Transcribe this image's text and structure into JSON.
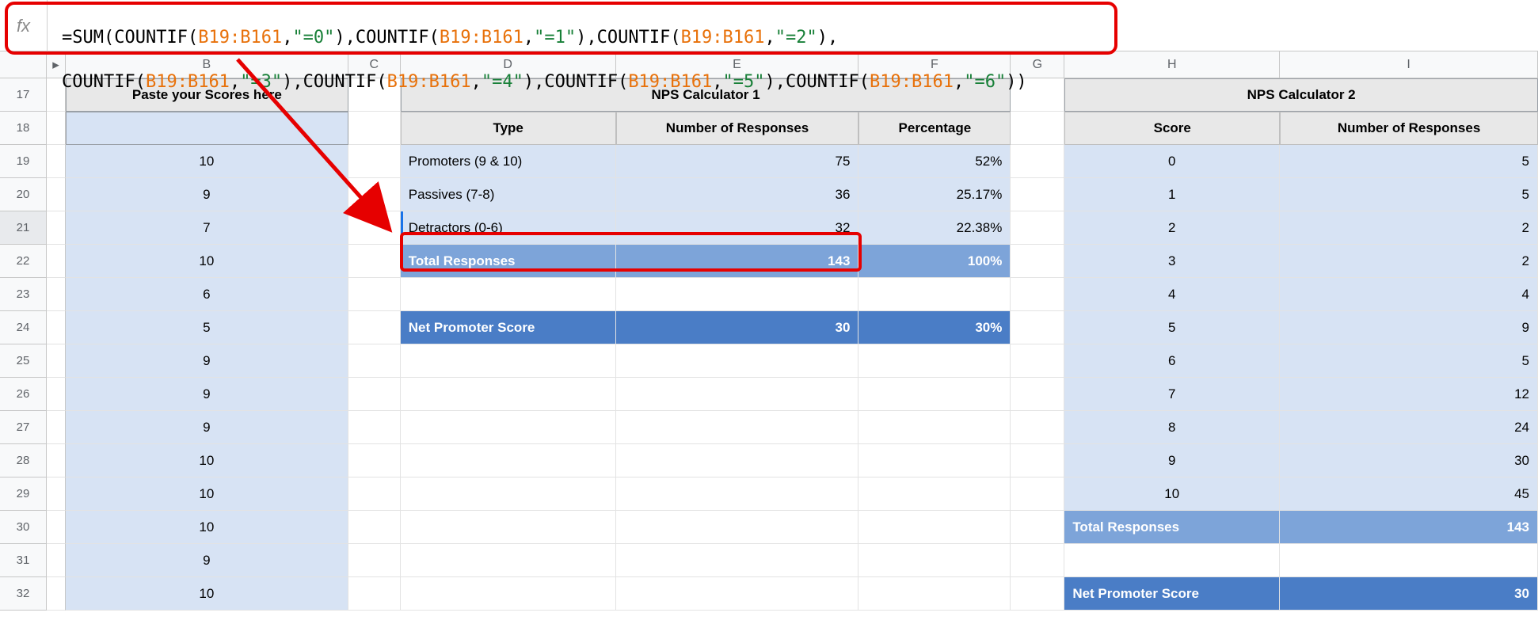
{
  "formula": {
    "text": "=SUM(COUNTIF(B19:B161,\"=0\"),COUNTIF(B19:B161,\"=1\"),COUNTIF(B19:B161,\"=2\"),\nCOUNTIF(B19:B161,\"=3\"),COUNTIF(B19:B161,\"=4\"),COUNTIF(B19:B161,\"=5\"),COUNTIF(B19:B161,\"=6\"))"
  },
  "columns": [
    "B",
    "C",
    "D",
    "E",
    "F",
    "G",
    "H",
    "I"
  ],
  "row_start": 17,
  "row_end": 32,
  "colB_header": "Paste your Scores here",
  "colB_values": [
    "",
    "10",
    "9",
    "7",
    "10",
    "6",
    "5",
    "9",
    "9",
    "9",
    "10",
    "10",
    "10",
    "9",
    "10"
  ],
  "calc1_title": "NPS Calculator 1",
  "calc1_headers": {
    "type": "Type",
    "num": "Number of Responses",
    "pct": "Percentage"
  },
  "calc1_rows": [
    {
      "type": "Promoters (9 & 10)",
      "num": "75",
      "pct": "52%"
    },
    {
      "type": "Passives (7-8)",
      "num": "36",
      "pct": "25.17%"
    },
    {
      "type": "Detractors (0-6)",
      "num": "32",
      "pct": "22.38%"
    }
  ],
  "calc1_total": {
    "label": "Total Responses",
    "num": "143",
    "pct": "100%"
  },
  "calc1_nps": {
    "label": "Net Promoter Score",
    "num": "30",
    "pct": "30%"
  },
  "calc2_title": "NPS Calculator 2",
  "calc2_headers": {
    "score": "Score",
    "num": "Number of Responses"
  },
  "calc2_rows": [
    {
      "score": "0",
      "num": "5"
    },
    {
      "score": "1",
      "num": "5"
    },
    {
      "score": "2",
      "num": "2"
    },
    {
      "score": "3",
      "num": "2"
    },
    {
      "score": "4",
      "num": "4"
    },
    {
      "score": "5",
      "num": "9"
    },
    {
      "score": "6",
      "num": "5"
    },
    {
      "score": "7",
      "num": "12"
    },
    {
      "score": "8",
      "num": "24"
    },
    {
      "score": "9",
      "num": "30"
    },
    {
      "score": "10",
      "num": "45"
    }
  ],
  "calc2_total": {
    "label": "Total Responses",
    "num": "143"
  },
  "calc2_nps": {
    "label": "Net Promoter Score",
    "num": "30"
  },
  "icons": {
    "fx": "fx",
    "expand": "▸"
  }
}
